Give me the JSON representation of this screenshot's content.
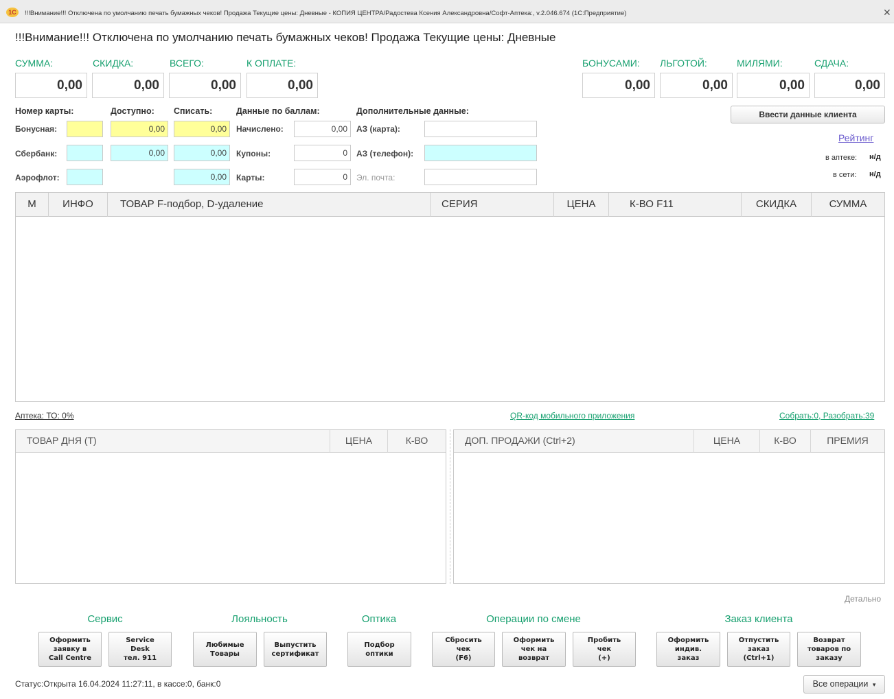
{
  "window": {
    "logo": "1С",
    "title": "!!!Внимание!!! Отключена по умолчанию печать бумажных чеков! Продажа Текущие цены: Дневные - КОПИЯ ЦЕНТРА/Радостева Ксения Александровна/Софт-Аптека:, v.2.046.674  (1С:Предприятие)",
    "close": "✕"
  },
  "page_title": "!!!Внимание!!! Отключена по умолчанию печать бумажных чеков! Продажа Текущие цены: Дневные",
  "totals": {
    "summa": {
      "label": "СУММА:",
      "value": "0,00"
    },
    "skidka": {
      "label": "СКИДКА:",
      "value": "0,00"
    },
    "vsego": {
      "label": "ВСЕГО:",
      "value": "0,00"
    },
    "k_oplate": {
      "label": "К ОПЛАТЕ:",
      "value": "0,00"
    },
    "bonusami": {
      "label": "БОНУСАМИ:",
      "value": "0,00"
    },
    "lgotoy": {
      "label": "ЛЬГОТОЙ:",
      "value": "0,00"
    },
    "milyami": {
      "label": "МИЛЯМИ:",
      "value": "0,00"
    },
    "sdacha": {
      "label": "СДАЧА:",
      "value": "0,00"
    }
  },
  "cards": {
    "header_card_number": "Номер карты:",
    "header_available": "Доступно:",
    "header_writeoff": "Списать:",
    "header_points": "Данные по баллам:",
    "header_extra": "Дополнительные данные:",
    "bonus": {
      "label": "Бонусная:",
      "number": "",
      "available": "0,00",
      "writeoff": "0,00"
    },
    "sber": {
      "label": "Сбербанк:",
      "number": "",
      "available": "0,00",
      "writeoff": "0,00"
    },
    "aeroflot": {
      "label": "Аэрофлот:",
      "number": "",
      "writeoff": "0,00"
    },
    "nachisleno": {
      "label": "Начислено:",
      "value": "0,00"
    },
    "kupony": {
      "label": "Купоны:",
      "value": "0"
    },
    "karty": {
      "label": "Карты:",
      "value": "0"
    },
    "az_card": {
      "label": "АЗ (карта):",
      "value": ""
    },
    "az_phone": {
      "label": "АЗ (телефон):",
      "value": ""
    },
    "email": {
      "label": "Эл. почта:",
      "value": ""
    }
  },
  "client": {
    "enter_button": "Ввести данные клиента",
    "rating_link": "Рейтинг",
    "in_pharmacy_label": "в аптеке:",
    "in_pharmacy_value": "н/д",
    "in_network_label": "в сети:",
    "in_network_value": "н/д"
  },
  "main_table": {
    "columns": [
      "М",
      "ИНФО",
      "ТОВАР  F-подбор, D-удаление",
      "СЕРИЯ",
      "ЦЕНА",
      "К-ВО F11",
      "СКИДКА",
      "СУММА"
    ]
  },
  "links": {
    "pharmacy_to": "Аптека: ТО: 0%",
    "qr": "QR-код мобильного приложения",
    "collect": "Собрать:0, Разобрать:39"
  },
  "day_table": {
    "columns": [
      "ТОВАР ДНЯ (Т)",
      "ЦЕНА",
      "К-ВО"
    ]
  },
  "extra_table": {
    "columns": [
      "ДОП. ПРОДАЖИ (Ctrl+2)",
      "ЦЕНА",
      "К-ВО",
      "ПРЕМИЯ"
    ]
  },
  "detail_link": "Детально",
  "groups": {
    "service": "Сервис",
    "loyalty": "Лояльность",
    "optics": "Оптика",
    "shift": "Операции по смене",
    "order": "Заказ клиента"
  },
  "buttons": {
    "call_centre": "Оформить\nзаявку в\nCall Centre",
    "service_desk": "Service\nDesk\nтел. 911",
    "favorites": "Любимые\nТовары",
    "certificate": "Выпустить\nсертификат",
    "optics_select": "Подбор\nоптики",
    "reset_check": "Сбросить\nчек\n(F6)",
    "return_check": "Оформить\nчек на\nвозврат",
    "punch_check": "Пробить\nчек\n(+)",
    "individual_order": "Оформить\nиндив.\nзаказ",
    "release_order": "Отпустить\nзаказ\n(Ctrl+1)",
    "return_goods": "Возврат\nтоваров по\nзаказу"
  },
  "status": "Статус:Открыта 16.04.2024 11:27:11, в кассе:0, банк:0",
  "all_operations": "Все операции"
}
